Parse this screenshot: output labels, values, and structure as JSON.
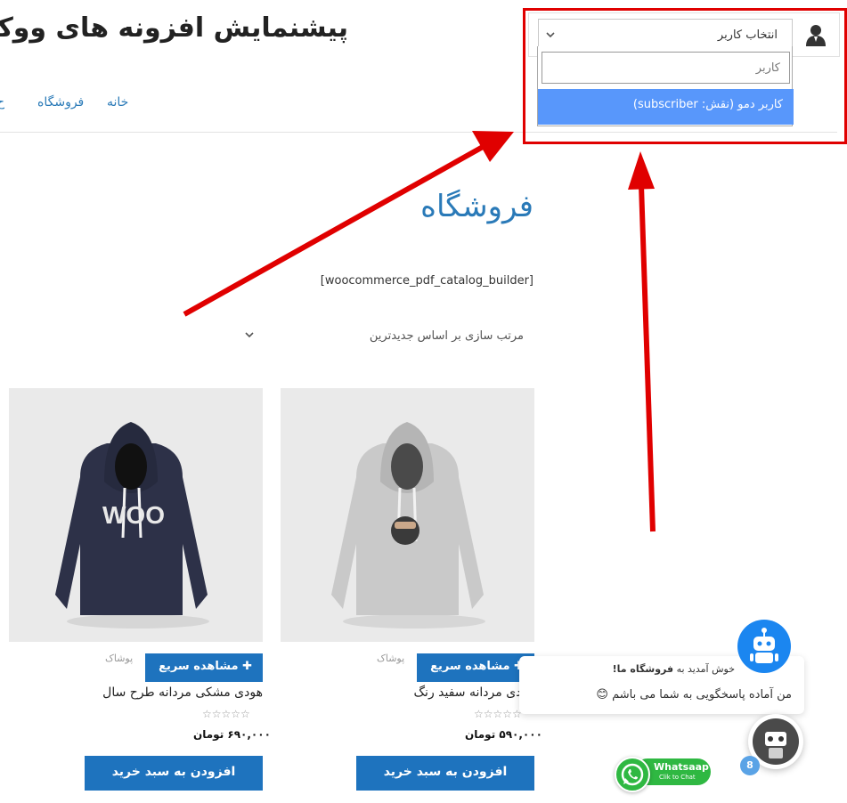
{
  "colors": {
    "accent": "#1e73be",
    "link": "#2a7ab8",
    "highlight": "#5897fb",
    "annotation": "#e00000",
    "whatsapp": "#2fb842",
    "bot": "#1b86f0"
  },
  "header": {
    "site_title": "پیشنمایش افزونه های ووکام",
    "nav": [
      {
        "label": "خانه"
      },
      {
        "label": "فروشگاه"
      },
      {
        "label": "ح"
      }
    ]
  },
  "user_switcher": {
    "icon": "user-icon",
    "select_label": "انتخاب کاربر",
    "search_placeholder": "کاربر",
    "search_value": "",
    "option": "کاربر دمو (نقش: subscriber)"
  },
  "main": {
    "page_title": "فروشگاه",
    "shortcode": "[woocommerce_pdf_catalog_builder]",
    "orderby": "مرتب سازی بر اساس جدیدترین"
  },
  "products": [
    {
      "category": "پوشاک",
      "quick_view": "مشاهده سریع",
      "title": "هودی مردانه سفید رنگ",
      "rating": "☆☆☆☆☆",
      "price": "۵۹۰,۰۰۰ تومان",
      "add_to_cart": "افزودن به سبد خرید",
      "logo": ""
    },
    {
      "category": "پوشاک",
      "quick_view": "مشاهده سریع",
      "title": "هودی مشکی مردانه طرح سال",
      "rating": "☆☆☆☆☆",
      "price": "۶۹۰,۰۰۰ تومان",
      "add_to_cart": "افزودن به سبد خرید",
      "logo": "WOO"
    }
  ],
  "chat": {
    "welcome_prefix": "خوش آمدید به ",
    "welcome_store": "فروشگاه ما!",
    "message": "من آماده پاسخگویی به شما می باشم 😊",
    "badge_count": "8",
    "whatsapp_title": "Whatsaap",
    "whatsapp_sub": "Clik to Chat"
  }
}
